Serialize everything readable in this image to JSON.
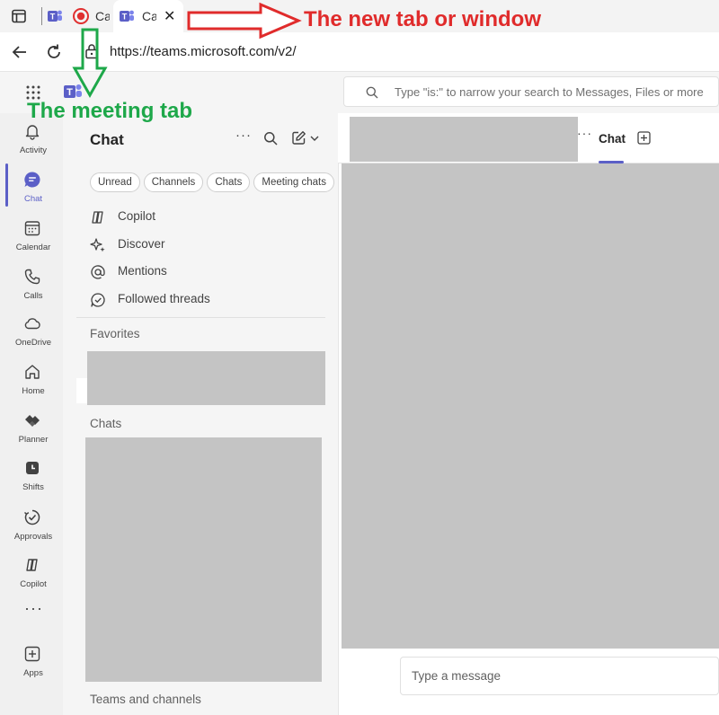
{
  "browser": {
    "tabs": [
      {
        "title": "",
        "icon": "teams-icon"
      },
      {
        "title": "Ca",
        "icon": "record-icon"
      },
      {
        "title": "Ca",
        "icon": "teams-icon",
        "active": true
      }
    ],
    "url": "https://teams.microsoft.com/v2/"
  },
  "search": {
    "placeholder": "Type \"is:\" to narrow your search to Messages, Files or more"
  },
  "rail": {
    "items": [
      {
        "label": "Activity",
        "icon": "bell-icon"
      },
      {
        "label": "Chat",
        "icon": "chat-icon",
        "active": true
      },
      {
        "label": "Calendar",
        "icon": "calendar-icon"
      },
      {
        "label": "Calls",
        "icon": "phone-icon"
      },
      {
        "label": "OneDrive",
        "icon": "cloud-icon"
      },
      {
        "label": "Home",
        "icon": "home-icon"
      },
      {
        "label": "Planner",
        "icon": "planner-icon"
      },
      {
        "label": "Shifts",
        "icon": "shifts-icon"
      },
      {
        "label": "Approvals",
        "icon": "approvals-icon"
      },
      {
        "label": "Copilot",
        "icon": "copilot-icon"
      },
      {
        "label": "Apps",
        "icon": "apps-icon"
      }
    ],
    "more": "···"
  },
  "chat_pane": {
    "title": "Chat",
    "more": "···",
    "filters": [
      "Unread",
      "Channels",
      "Chats",
      "Meeting chats"
    ],
    "items": [
      {
        "label": "Copilot",
        "icon": "copilot-icon"
      },
      {
        "label": "Discover",
        "icon": "sparkle-icon"
      },
      {
        "label": "Mentions",
        "icon": "at-icon"
      },
      {
        "label": "Followed threads",
        "icon": "followed-threads-icon"
      }
    ],
    "sections": {
      "favorites": "Favorites",
      "chats": "Chats",
      "teams": "Teams and channels"
    }
  },
  "conversation": {
    "more": "···",
    "tab": "Chat",
    "composer_placeholder": "Type a message"
  },
  "annotations": {
    "new_tab": "The new tab or window",
    "meeting_tab": "The meeting tab"
  },
  "colors": {
    "accent": "#5b5fc7",
    "annotation_red": "#e02b2b",
    "annotation_green": "#1ea84a",
    "redaction": "#c4c4c4"
  }
}
